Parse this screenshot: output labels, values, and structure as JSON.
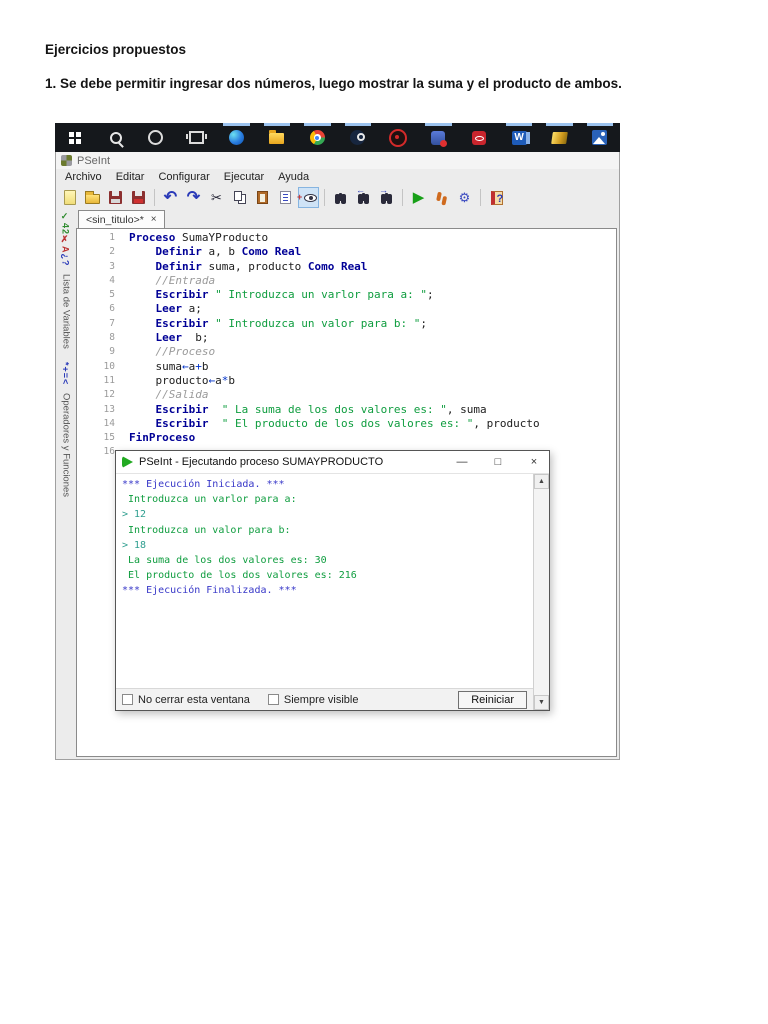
{
  "document": {
    "heading": "Ejercicios propuestos",
    "paragraph": "1. Se debe permitir ingresar dos números, luego mostrar la suma y el producto de ambos."
  },
  "taskbar": {
    "icons": [
      {
        "name": "start"
      },
      {
        "name": "search"
      },
      {
        "name": "cortana"
      },
      {
        "name": "task-view"
      },
      {
        "name": "edge",
        "indicator": true
      },
      {
        "name": "file-explorer",
        "indicator": true
      },
      {
        "name": "chrome",
        "indicator": true
      },
      {
        "name": "steam",
        "indicator": true
      },
      {
        "name": "settings-red"
      },
      {
        "name": "mail",
        "indicator": true
      },
      {
        "name": "adobe"
      },
      {
        "name": "word",
        "indicator": true
      },
      {
        "name": "game",
        "indicator": true
      },
      {
        "name": "photos",
        "indicator": true
      }
    ]
  },
  "pseint": {
    "title": "PSeInt",
    "menu": [
      "Archivo",
      "Editar",
      "Configurar",
      "Ejecutar",
      "Ayuda"
    ],
    "toolbar": [
      {
        "name": "new-file"
      },
      {
        "name": "open-file"
      },
      {
        "name": "save"
      },
      {
        "name": "save-as"
      },
      {
        "name": "sep"
      },
      {
        "name": "undo",
        "glyph": "↶"
      },
      {
        "name": "redo",
        "glyph": "↷"
      },
      {
        "name": "cut",
        "glyph": "✂"
      },
      {
        "name": "copy"
      },
      {
        "name": "paste"
      },
      {
        "name": "format"
      },
      {
        "name": "syntax-eye",
        "selected": true
      },
      {
        "name": "sep"
      },
      {
        "name": "find"
      },
      {
        "name": "find-prev"
      },
      {
        "name": "find-next"
      },
      {
        "name": "sep"
      },
      {
        "name": "run",
        "glyph": "▶"
      },
      {
        "name": "step-run"
      },
      {
        "name": "flowchart",
        "glyph": "⚙"
      },
      {
        "name": "sep"
      },
      {
        "name": "help"
      }
    ],
    "tab_label": "<sin_titulo>*",
    "tab_close": "×",
    "side_panels": [
      {
        "icon_parts": [
          [
            "#2e8b2e",
            "✓42"
          ],
          [
            "#bb3333",
            "✗A"
          ],
          [
            "#2a3ab8",
            "¿?"
          ]
        ],
        "label": "Lista de Variables"
      },
      {
        "icon_parts": [
          [
            "#2a3ab8",
            "*+=<"
          ]
        ],
        "label": "Operadores y Funciones"
      }
    ],
    "code": [
      {
        "n": "1",
        "t": [
          [
            "kw",
            "Proceso"
          ],
          [
            "pl",
            " SumaYProducto"
          ]
        ]
      },
      {
        "n": "2",
        "t": [
          [
            "pl",
            "    "
          ],
          [
            "kw",
            "Definir"
          ],
          [
            "pl",
            " a, b "
          ],
          [
            "kw",
            "Como Real"
          ]
        ]
      },
      {
        "n": "3",
        "t": [
          [
            "pl",
            "    "
          ],
          [
            "kw",
            "Definir"
          ],
          [
            "pl",
            " suma, producto "
          ],
          [
            "kw",
            "Como Real"
          ]
        ]
      },
      {
        "n": "4",
        "t": [
          [
            "cmt",
            "    //Entrada"
          ]
        ]
      },
      {
        "n": "5",
        "t": [
          [
            "pl",
            "    "
          ],
          [
            "kw",
            "Escribir"
          ],
          [
            "str",
            " \" Introduzca un varlor para a: \""
          ],
          [
            "pl",
            ";"
          ]
        ]
      },
      {
        "n": "6",
        "t": [
          [
            "pl",
            "    "
          ],
          [
            "kw",
            "Leer"
          ],
          [
            "pl",
            " a;"
          ]
        ]
      },
      {
        "n": "7",
        "t": [
          [
            "pl",
            "    "
          ],
          [
            "kw",
            "Escribir"
          ],
          [
            "str",
            " \" Introduzca un valor para b: \""
          ],
          [
            "pl",
            ";"
          ]
        ]
      },
      {
        "n": "8",
        "t": [
          [
            "pl",
            "    "
          ],
          [
            "kw",
            "Leer"
          ],
          [
            "pl",
            "  b;"
          ]
        ]
      },
      {
        "n": "9",
        "t": [
          [
            "cmt",
            "    //Proceso"
          ]
        ]
      },
      {
        "n": "10",
        "t": [
          [
            "pl",
            "    suma"
          ],
          [
            "op",
            "←"
          ],
          [
            "pl",
            "a"
          ],
          [
            "op",
            "+"
          ],
          [
            "pl",
            "b"
          ]
        ]
      },
      {
        "n": "11",
        "t": [
          [
            "pl",
            "    producto"
          ],
          [
            "op",
            "←"
          ],
          [
            "pl",
            "a"
          ],
          [
            "op",
            "*"
          ],
          [
            "pl",
            "b"
          ]
        ]
      },
      {
        "n": "12",
        "t": [
          [
            "cmt",
            "    //Salida"
          ]
        ]
      },
      {
        "n": "13",
        "t": [
          [
            "pl",
            "    "
          ],
          [
            "kw",
            "Escribir"
          ],
          [
            "pl",
            "  "
          ],
          [
            "str",
            "\" La suma de los dos valores es: \""
          ],
          [
            "pl",
            ", suma"
          ]
        ]
      },
      {
        "n": "14",
        "t": [
          [
            "pl",
            "    "
          ],
          [
            "kw",
            "Escribir"
          ],
          [
            "pl",
            "  "
          ],
          [
            "str",
            "\" El producto de los dos valores es: \""
          ],
          [
            "pl",
            ", producto"
          ]
        ]
      },
      {
        "n": "15",
        "t": [
          [
            "kw",
            "FinProceso"
          ]
        ]
      },
      {
        "n": "16",
        "t": []
      }
    ]
  },
  "runner": {
    "title": "PSeInt - Ejecutando proceso SUMAYPRODUCTO",
    "minimize": "—",
    "maximize": "□",
    "close": "×",
    "console": [
      {
        "c": "sys",
        "t": "*** Ejecución Iniciada. ***"
      },
      {
        "c": "out",
        "t": " Introduzca un varlor para a: "
      },
      {
        "c": "in",
        "t": "> 12"
      },
      {
        "c": "out",
        "t": " Introduzca un valor para b: "
      },
      {
        "c": "in",
        "t": "> 18"
      },
      {
        "c": "out",
        "t": " La suma de los dos valores es: 30"
      },
      {
        "c": "out",
        "t": " El producto de los dos valores es: 216"
      },
      {
        "c": "sys",
        "t": "*** Ejecución Finalizada. ***"
      }
    ],
    "options": [
      {
        "label": "No cerrar esta ventana",
        "checked": false
      },
      {
        "label": "Siempre visible",
        "checked": false
      }
    ],
    "restart": "Reiniciar",
    "scroll_up": "▲",
    "scroll_down": "▼"
  }
}
